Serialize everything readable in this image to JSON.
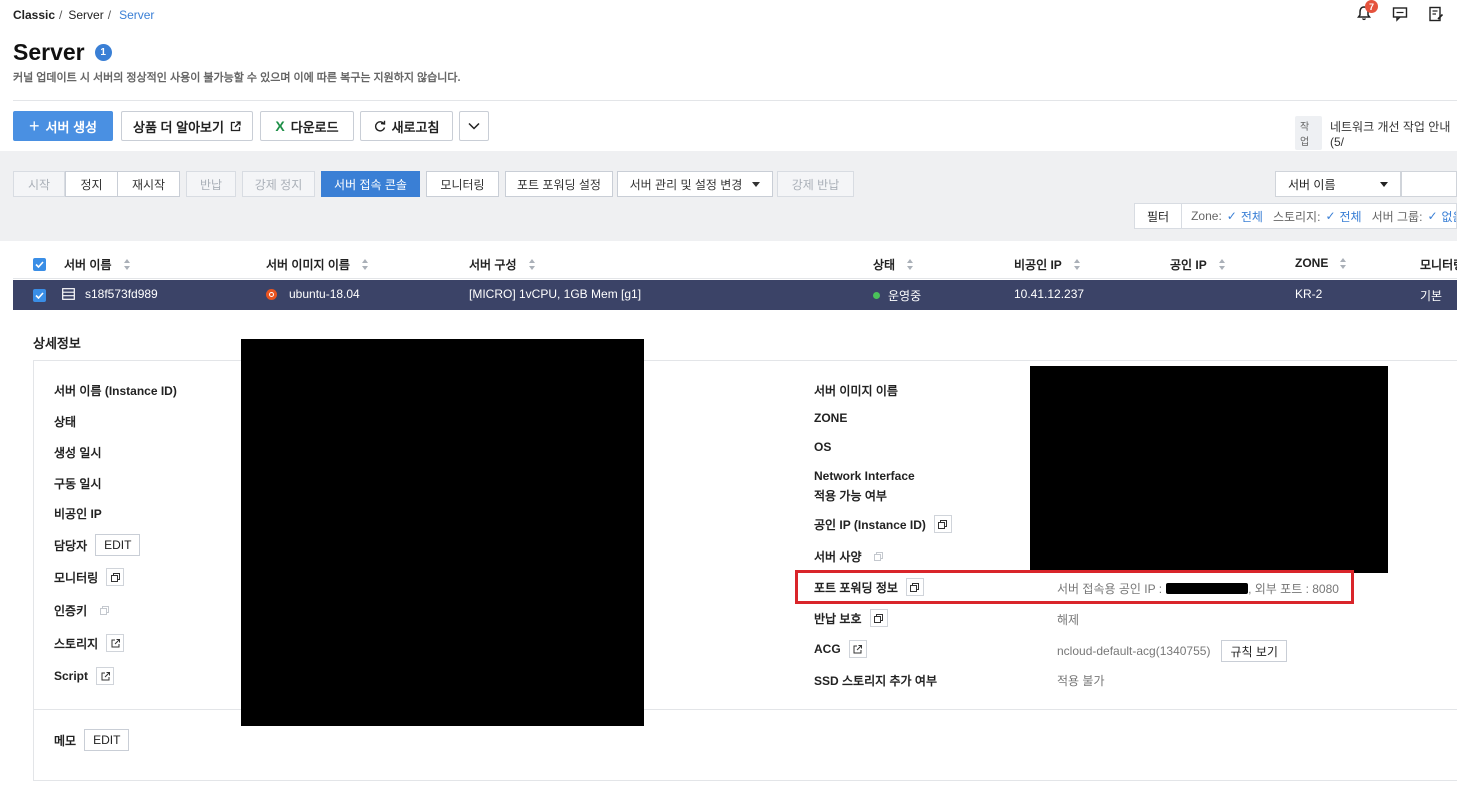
{
  "breadcrumb": {
    "root": "Classic",
    "mid": "Server",
    "current": "Server",
    "sep1": "/",
    "sep2": "/"
  },
  "header": {
    "title": "Server",
    "count_badge": "1",
    "notice": "커널 업데이트 시 서버의 정상적인 사용이 불가능할 수 있으며 이에 따른 복구는 지원하지 않습니다.",
    "notification_count": "7"
  },
  "toolbar": {
    "create": "서버 생성",
    "learn_more": "상품 더 알아보기",
    "download": "다운로드",
    "refresh": "새로고침"
  },
  "announcement": {
    "tag": "작업",
    "text": "네트워크 개선 작업 안내 (5/"
  },
  "actions": {
    "start": "시작",
    "stop": "정지",
    "restart": "재시작",
    "return": "반납",
    "force_stop": "강제 정지",
    "console": "서버 접속 콘솔",
    "monitoring": "모니터링",
    "port_forwarding": "포트 포워딩 설정",
    "manage": "서버 관리 및 설정 변경",
    "force_return": "강제 반납"
  },
  "search": {
    "select_value": "서버 이름"
  },
  "filter": {
    "button": "필터",
    "zone_label": "Zone:",
    "zone_value": "전체",
    "storage_label": "스토리지:",
    "storage_value": "전체",
    "group_label": "서버 그룹:",
    "group_value": "없음"
  },
  "table": {
    "headers": {
      "name": "서버 이름",
      "image": "서버 이미지 이름",
      "spec": "서버 구성",
      "status": "상태",
      "private_ip": "비공인 IP",
      "public_ip": "공인 IP",
      "zone": "ZONE",
      "monitoring": "모니터링"
    },
    "row": {
      "name": "s18f573fd989",
      "image": "ubuntu-18.04",
      "spec": "[MICRO] 1vCPU, 1GB Mem [g1]",
      "status": "운영중",
      "private_ip": "10.41.12.237",
      "public_ip": "",
      "zone": "KR-2",
      "monitoring": "기본"
    }
  },
  "detail": {
    "title": "상세정보",
    "left": {
      "instance_id": "서버 이름 (Instance ID)",
      "status": "상태",
      "created": "생성 일시",
      "started": "구동 일시",
      "private_ip": "비공인 IP",
      "owner": "담당자",
      "monitoring": "모니터링",
      "auth_key": "인증키",
      "storage": "스토리지",
      "script": "Script",
      "edit": "EDIT"
    },
    "right": {
      "image_name": "서버 이미지 이름",
      "zone": "ZONE",
      "os": "OS",
      "ni_line1": "Network Interface",
      "ni_line2": "적용 가능 여부",
      "public_ip": "공인 IP (Instance ID)",
      "spec": "서버 사양",
      "port_forwarding": "포트 포워딩 정보",
      "return_protection": "반납 보호",
      "acg": "ACG",
      "ssd": "SSD 스토리지 추가 여부"
    },
    "values": {
      "pf_ip_label": "서버 접속용 공인 IP :",
      "pf_port": ", 외부 포트 : 8080",
      "return_protection": "해제",
      "acg": "ncloud-default-acg(1340755)",
      "acg_rules": "규칙 보기",
      "ssd": "적용 불가"
    },
    "memo": "메모",
    "memo_edit": "EDIT"
  },
  "colors": {
    "primary": "#4a90e2",
    "selected_row": "#3b4367",
    "status_green": "#4ac25a",
    "highlight": "#d9252a"
  }
}
